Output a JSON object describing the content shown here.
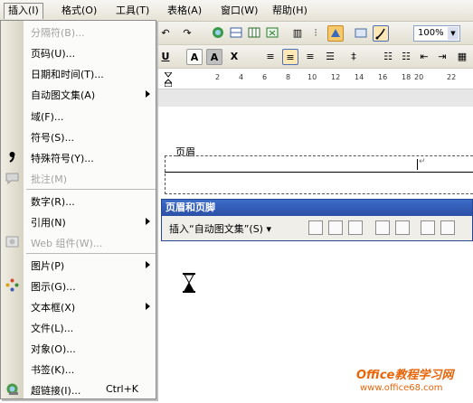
{
  "menubar": {
    "items": [
      "插入(I)",
      "格式(O)",
      "工具(T)",
      "表格(A)",
      "窗口(W)",
      "帮助(H)"
    ]
  },
  "insert_menu": {
    "items": [
      {
        "label": "分隔符(B)...",
        "enabled": false
      },
      {
        "label": "页码(U)...",
        "enabled": true
      },
      {
        "label": "日期和时间(T)...",
        "enabled": true
      },
      {
        "label": "自动图文集(A)",
        "enabled": true,
        "submenu": true
      },
      {
        "label": "域(F)...",
        "enabled": true
      },
      {
        "label": "符号(S)...",
        "enabled": true
      },
      {
        "label": "特殊符号(Y)...",
        "enabled": true
      },
      {
        "label": "批注(M)",
        "enabled": false
      },
      {
        "label": "数字(R)...",
        "enabled": true
      },
      {
        "label": "引用(N)",
        "enabled": true,
        "submenu": true
      },
      {
        "label": "Web 组件(W)...",
        "enabled": false
      },
      {
        "label": "图片(P)",
        "enabled": true,
        "submenu": true
      },
      {
        "label": "图示(G)...",
        "enabled": true
      },
      {
        "label": "文本框(X)",
        "enabled": true,
        "submenu": true
      },
      {
        "label": "文件(L)...",
        "enabled": true
      },
      {
        "label": "对象(O)...",
        "enabled": true
      },
      {
        "label": "书签(K)...",
        "enabled": true
      },
      {
        "label": "超链接(I)...",
        "enabled": true,
        "shortcut": "Ctrl+K"
      }
    ]
  },
  "toolbar": {
    "zoom": "100%",
    "bold_label": "U",
    "a_label": "A",
    "b_label": "A",
    "c_label": "X"
  },
  "ruler": {
    "numbers": [
      "2",
      "4",
      "6",
      "8",
      "10",
      "12",
      "14",
      "16",
      "18",
      "20",
      "22"
    ]
  },
  "document": {
    "header_label": "页眉",
    "para_mark": "↵"
  },
  "header_footer_toolbar": {
    "title": "页眉和页脚",
    "insert_autotext": "插入“自动图文集”(S) ▾"
  },
  "watermark": {
    "title": "Office教程学习网",
    "url": "www.office68.com"
  },
  "colors": {
    "menu_highlight": "#c7d6ee",
    "title_bar": "#2a4fa6",
    "watermark": "#e8650a"
  }
}
